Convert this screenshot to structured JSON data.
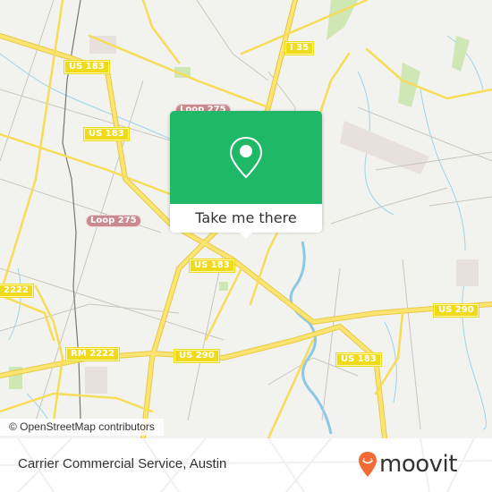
{
  "map": {
    "shields": [
      {
        "label": "US 183",
        "type": "us"
      },
      {
        "label": "US 183",
        "type": "us"
      },
      {
        "label": "Loop 275",
        "type": "loop"
      },
      {
        "label": "Loop 275",
        "type": "loop"
      },
      {
        "label": "I 35",
        "type": "us"
      },
      {
        "label": "US 183",
        "type": "us"
      },
      {
        "label": "2222",
        "type": "us"
      },
      {
        "label": "RM 2222",
        "type": "us"
      },
      {
        "label": "US 290",
        "type": "us"
      },
      {
        "label": "US 290",
        "type": "us"
      },
      {
        "label": "US 183",
        "type": "us"
      }
    ],
    "attribution": "© OpenStreetMap contributors"
  },
  "popup": {
    "icon": "map-pin-icon",
    "button_label": "Take me there",
    "color": "#1fb866"
  },
  "footer": {
    "place_name": "Carrier Commercial Service, Austin",
    "brand": "moovit",
    "brand_color": "#f26a35"
  }
}
